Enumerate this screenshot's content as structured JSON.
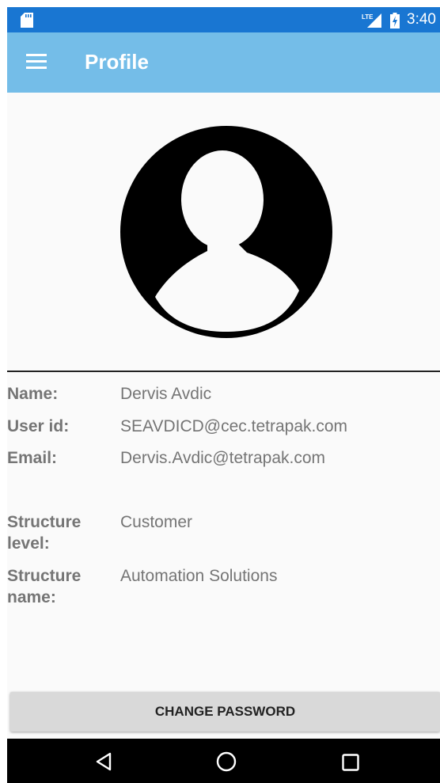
{
  "status_bar": {
    "time": "3:40",
    "network": "LTE",
    "icons": [
      "sd-card-icon",
      "lte-signal-icon",
      "battery-charging-icon"
    ]
  },
  "app_bar": {
    "title": "Profile",
    "menu_icon": "hamburger-menu-icon"
  },
  "profile": {
    "avatar_icon": "person-avatar-icon",
    "fields": {
      "name": {
        "label": "Name:",
        "value": "Dervis Avdic"
      },
      "user_id": {
        "label": "User id:",
        "value": "SEAVDICD@cec.tetrapak.com"
      },
      "email": {
        "label": "Email:",
        "value": "Dervis.Avdic@tetrapak.com"
      },
      "structure_level": {
        "label": "Structure level:",
        "value": "Customer"
      },
      "structure_name": {
        "label": "Structure name:",
        "value": "Automation Solutions"
      }
    }
  },
  "actions": {
    "change_password": "CHANGE PASSWORD"
  },
  "nav_bar": {
    "icons": [
      "back-icon",
      "home-icon",
      "recents-icon"
    ]
  },
  "colors": {
    "status_bar": "#1976d2",
    "app_bar": "#74bde8",
    "background": "#fafafa",
    "button": "#d9d9d9",
    "text_gray": "#757575"
  }
}
